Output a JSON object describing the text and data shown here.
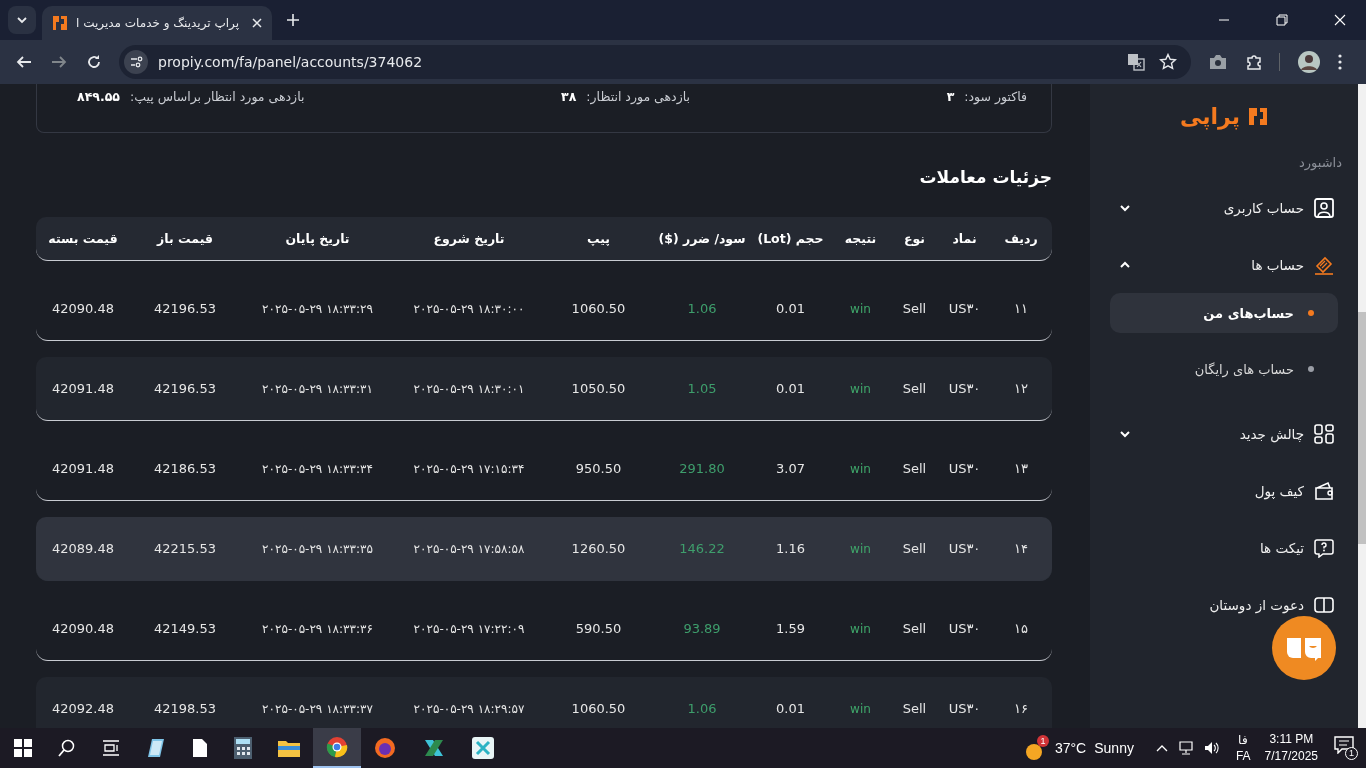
{
  "browser": {
    "tab_title": "پراپ تریدینگ و خدمات مدیریت ا",
    "url": "propiy.com/fa/panel/accounts/374062"
  },
  "summary": [
    {
      "label": "فاکتور سود:",
      "value": "۳"
    },
    {
      "label": "بازدهی مورد انتظار:",
      "value": "۳۸"
    },
    {
      "label": "بازدهی مورد انتظار براساس پیپ:",
      "value": "۸۴۹.۵۵"
    }
  ],
  "trades": {
    "title": "جزئیات معاملات",
    "columns": [
      "ردیف",
      "نماد",
      "نوع",
      "نتیجه",
      "حجم (Lot)",
      "سود/ ضرر ($)",
      "پیپ",
      "تاریخ شروع",
      "تاریخ پایان",
      "قیمت باز",
      "قیمت بسته"
    ],
    "rows": [
      {
        "selected": false,
        "cells": [
          "۱۱",
          "US۳۰",
          "Sell",
          "win",
          "0.01",
          "1.06",
          "1060.50",
          "۲۰۲۵-۰۵-۲۹ ۱۸:۳۰:۰۰",
          "۲۰۲۵-۰۵-۲۹ ۱۸:۳۳:۲۹",
          "42196.53",
          "42090.48"
        ]
      },
      {
        "selected": false,
        "cells": [
          "۱۲",
          "US۳۰",
          "Sell",
          "win",
          "0.01",
          "1.05",
          "1050.50",
          "۲۰۲۵-۰۵-۲۹ ۱۸:۳۰:۰۱",
          "۲۰۲۵-۰۵-۲۹ ۱۸:۳۳:۳۱",
          "42196.53",
          "42091.48"
        ]
      },
      {
        "selected": false,
        "cells": [
          "۱۳",
          "US۳۰",
          "Sell",
          "win",
          "3.07",
          "291.80",
          "950.50",
          "۲۰۲۵-۰۵-۲۹ ۱۷:۱۵:۳۴",
          "۲۰۲۵-۰۵-۲۹ ۱۸:۳۳:۳۴",
          "42186.53",
          "42091.48"
        ]
      },
      {
        "selected": true,
        "cells": [
          "۱۴",
          "US۳۰",
          "Sell",
          "win",
          "1.16",
          "146.22",
          "1260.50",
          "۲۰۲۵-۰۵-۲۹ ۱۷:۵۸:۵۸",
          "۲۰۲۵-۰۵-۲۹ ۱۸:۳۳:۳۵",
          "42215.53",
          "42089.48"
        ]
      },
      {
        "selected": false,
        "cells": [
          "۱۵",
          "US۳۰",
          "Sell",
          "win",
          "1.59",
          "93.89",
          "590.50",
          "۲۰۲۵-۰۵-۲۹ ۱۷:۲۲:۰۹",
          "۲۰۲۵-۰۵-۲۹ ۱۸:۳۳:۳۶",
          "42149.53",
          "42090.48"
        ]
      },
      {
        "selected": false,
        "cells": [
          "۱۶",
          "US۳۰",
          "Sell",
          "win",
          "0.01",
          "1.06",
          "1060.50",
          "۲۰۲۵-۰۵-۲۹ ۱۸:۲۹:۵۷",
          "۲۰۲۵-۰۵-۲۹ ۱۸:۳۳:۳۷",
          "42198.53",
          "42092.48"
        ]
      }
    ]
  },
  "sidebar": {
    "logo": "پراپی",
    "section": "داشبورد",
    "items": [
      {
        "kind": "user",
        "label": "حساب کاربری",
        "expanded": false,
        "active": false
      },
      {
        "kind": "accounts",
        "label": "حساب ها",
        "expanded": true,
        "active": true,
        "children": [
          {
            "label": "حساب‌های من",
            "selected": true
          },
          {
            "label": "حساب های رایگان",
            "selected": false
          }
        ]
      },
      {
        "kind": "grid",
        "label": "چالش جدید",
        "expanded": false,
        "active": false
      },
      {
        "kind": "wallet",
        "label": "کیف پول",
        "active": false
      },
      {
        "kind": "ticket",
        "label": "تیکت ها",
        "active": false
      },
      {
        "kind": "invite",
        "label": "دعوت از دوستان",
        "active": false
      }
    ]
  },
  "taskbar": {
    "weather": {
      "badge": "1",
      "temp": "37°C",
      "condition": "Sunny"
    },
    "lang_top": "فا",
    "lang": "FA",
    "time": "3:11 PM",
    "date": "7/17/2025",
    "notifications": "1"
  }
}
